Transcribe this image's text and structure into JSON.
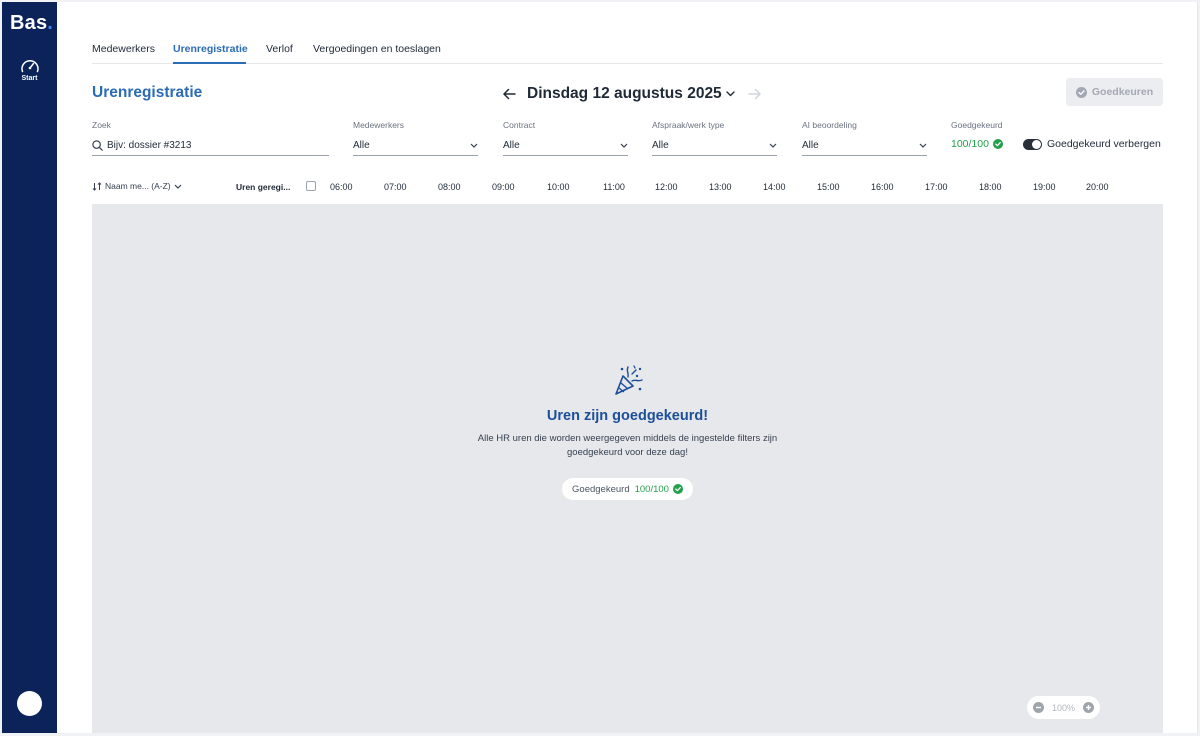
{
  "app": {
    "logo": "Bas",
    "logo_dot": "."
  },
  "sidebar": {
    "items": [
      {
        "label": "Start",
        "icon": "speedometer-icon"
      }
    ]
  },
  "tabs": [
    {
      "label": "Medewerkers",
      "active": false
    },
    {
      "label": "Urenregistratie",
      "active": true
    },
    {
      "label": "Verlof",
      "active": false
    },
    {
      "label": "Vergoedingen en toeslagen",
      "active": false
    }
  ],
  "header": {
    "title": "Urenregistratie",
    "date": "Dinsdag 12 augustus 2025",
    "approve_label": "Goedkeuren"
  },
  "filters": {
    "search": {
      "label": "Zoek",
      "placeholder": "Bijv: dossier #3213"
    },
    "employees": {
      "label": "Medewerkers",
      "value": "Alle"
    },
    "contract": {
      "label": "Contract",
      "value": "Alle"
    },
    "appointment_type": {
      "label": "Afspraak/werk type",
      "value": "Alle"
    },
    "ai_rating": {
      "label": "AI beoordeling",
      "value": "Alle"
    },
    "approved": {
      "label": "Goedgekeurd",
      "value": "100/100"
    },
    "hide_approved": {
      "label": "Goedgekeurd verbergen",
      "on": true
    }
  },
  "timeline": {
    "sort_label": "Naam me... (A-Z)",
    "hours_column": "Uren geregi...",
    "times": [
      "06:00",
      "07:00",
      "08:00",
      "09:00",
      "10:00",
      "11:00",
      "12:00",
      "13:00",
      "14:00",
      "15:00",
      "16:00",
      "17:00",
      "18:00",
      "19:00",
      "20:00"
    ]
  },
  "empty_state": {
    "title": "Uren zijn goedgekeurd!",
    "text": "Alle HR uren die worden weergegeven middels de ingestelde filters zijn goedgekeurd voor deze dag!",
    "pill_label": "Goedgekeurd",
    "pill_value": "100/100"
  },
  "zoom": {
    "value": "100%"
  },
  "colors": {
    "brand": "#0b2358",
    "accent": "#2b6cb5",
    "success": "#22a04b"
  }
}
